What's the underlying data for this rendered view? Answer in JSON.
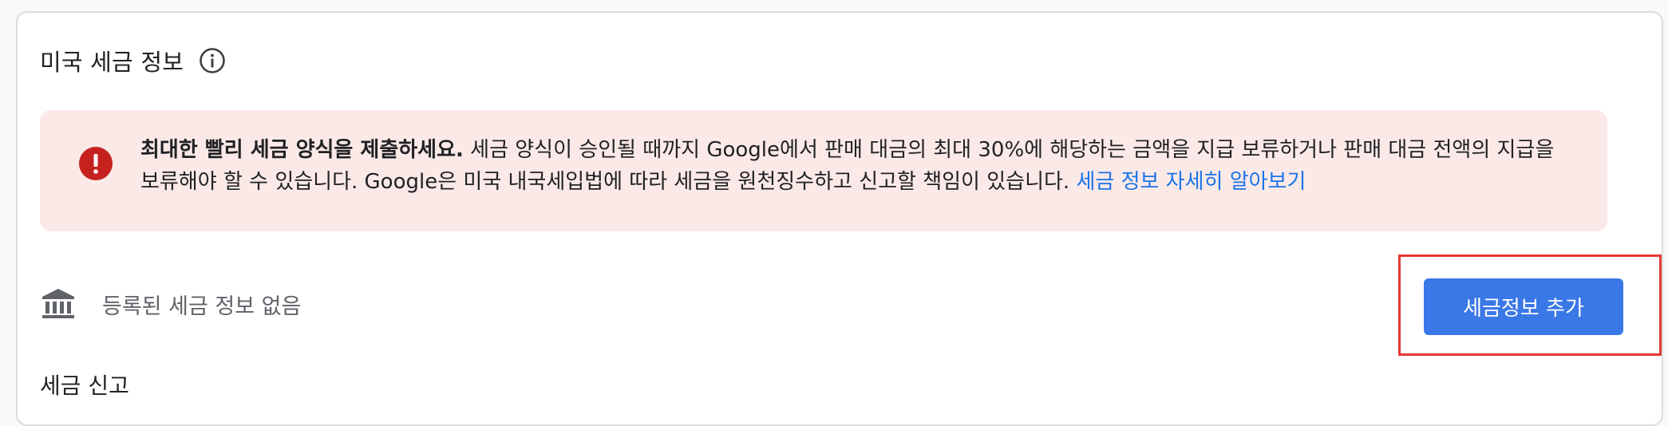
{
  "section": {
    "title": "미국 세금 정보",
    "info_icon": "info-circle-icon"
  },
  "alert": {
    "icon": "error-exclamation-icon",
    "bold_text": "최대한 빨리 세금 양식을 제출하세요.",
    "body_text": " 세금 양식이 승인될 때까지 Google에서 판매 대금의 최대 30%에 해당하는 금액을 지급 보류하거나 판매 대금 전액의 지급을 보류해야 할 수 있습니다. Google은 미국 내국세입법에 따라 세금을 원천징수하고 신고할 책임이 있습니다. ",
    "link_text": "세금 정보 자세히 알아보기",
    "background_color": "#fae9e7",
    "icon_color": "#c5221f"
  },
  "tax_info": {
    "icon": "bank-icon",
    "empty_text": "등록된 세금 정보 없음",
    "add_button_label": "세금정보 추가",
    "button_color": "#3b78e7",
    "highlight_color": "#e53935"
  },
  "filing": {
    "heading": "세금 신고"
  }
}
